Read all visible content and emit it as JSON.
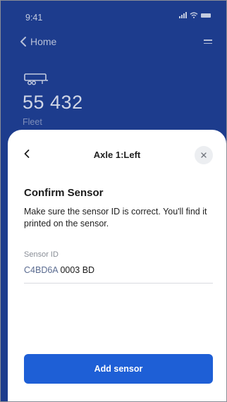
{
  "status_bar": {
    "time": "9:41"
  },
  "nav": {
    "back_label": "Home"
  },
  "vehicle": {
    "number": "55 432",
    "type_label": "Fleet"
  },
  "sheet": {
    "title": "Axle 1:Left",
    "heading": "Confirm Sensor",
    "description": "Make sure the sensor ID is correct. You'll find it printed on the sensor.",
    "field": {
      "label": "Sensor ID",
      "value_prefix": "C4BD6A",
      "value_suffix": "0003 BD"
    },
    "primary_button_label": "Add sensor"
  },
  "colors": {
    "header_background": "#1d3c8d",
    "primary_button": "#1e5fd6",
    "value_prefix": "#5a6b90"
  },
  "icons": [
    "chevron-left-icon",
    "menu-icon",
    "trailer-icon",
    "close-icon",
    "signal-icon",
    "wifi-icon",
    "battery-icon"
  ]
}
